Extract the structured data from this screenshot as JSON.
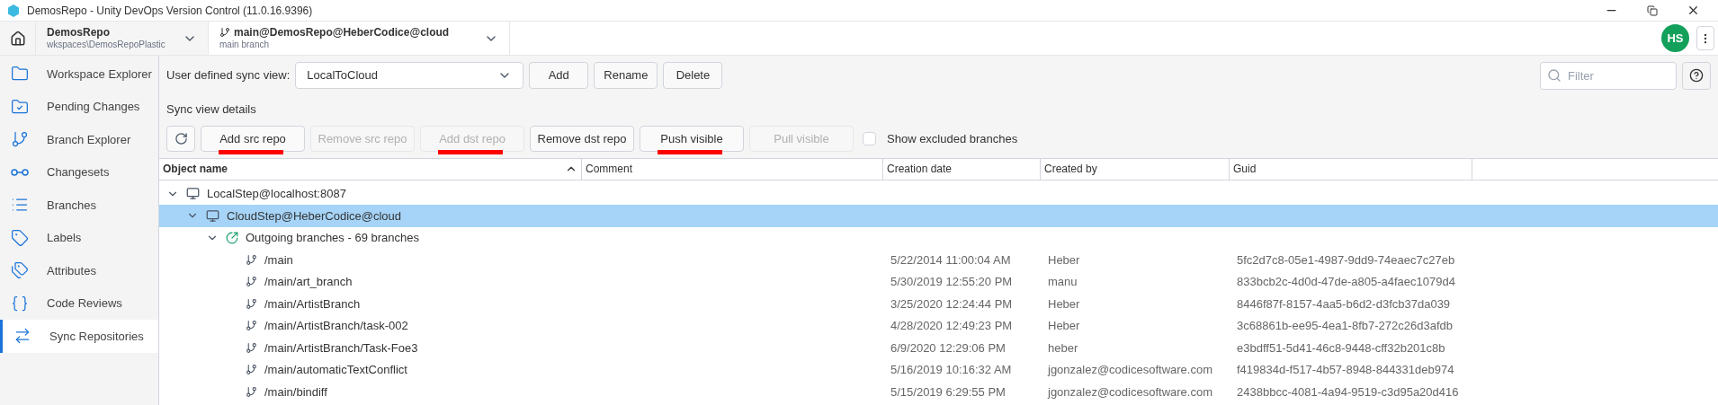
{
  "window": {
    "title": "DemosRepo - Unity DevOps Version Control (11.0.16.9396)"
  },
  "breadcrumbs": [
    {
      "kind": "workspace",
      "title": "DemosRepo",
      "subtitle": "wkspaces\\DemosRepoPlastic"
    },
    {
      "kind": "branch",
      "title": "main@DemosRepo@HeberCodice@cloud",
      "subtitle": "main branch"
    }
  ],
  "user": {
    "initials": "HS"
  },
  "sidebar": {
    "items": [
      {
        "kind": "folder",
        "label": "Workspace Explorer",
        "selected": false
      },
      {
        "kind": "pending",
        "label": "Pending Changes",
        "selected": false
      },
      {
        "kind": "branch-explorer",
        "label": "Branch Explorer",
        "selected": false
      },
      {
        "kind": "changesets",
        "label": "Changesets",
        "selected": false
      },
      {
        "kind": "list",
        "label": "Branches",
        "selected": false
      },
      {
        "kind": "label",
        "label": "Labels",
        "selected": false
      },
      {
        "kind": "attribute",
        "label": "Attributes",
        "selected": false
      },
      {
        "kind": "code",
        "label": "Code Reviews",
        "selected": false
      },
      {
        "kind": "sync",
        "label": "Sync Repositories",
        "selected": true
      }
    ]
  },
  "sync_view": {
    "label": "User defined sync view:",
    "value": "LocalToCloud",
    "buttons": [
      "Add",
      "Rename",
      "Delete"
    ]
  },
  "filter": {
    "placeholder": "Filter"
  },
  "details_label": "Sync view details",
  "actions": [
    {
      "label": "Add src repo",
      "disabled": false,
      "underlined": true
    },
    {
      "label": "Remove src repo",
      "disabled": true,
      "underlined": false
    },
    {
      "label": "Add dst repo",
      "disabled": true,
      "underlined": true
    },
    {
      "label": "Remove dst repo",
      "disabled": false,
      "underlined": false
    },
    {
      "label": "Push visible",
      "disabled": false,
      "underlined": true
    },
    {
      "label": "Pull visible",
      "disabled": true,
      "underlined": false
    }
  ],
  "show_excluded": {
    "label": "Show excluded branches",
    "checked": false
  },
  "table": {
    "columns": [
      "Object name",
      "Comment",
      "Creation date",
      "Created by",
      "Guid"
    ],
    "rows": [
      {
        "kind": "repo",
        "name": "LocalStep@localhost:8087",
        "expanded": true,
        "selected": false,
        "children": [
          {
            "kind": "repo",
            "name": "CloudStep@HeberCodice@cloud",
            "expanded": true,
            "selected": true,
            "children": [
              {
                "kind": "outgoing",
                "name": "Outgoing branches - 69 branches",
                "expanded": true,
                "selected": false,
                "children": [
                  {
                    "kind": "branch",
                    "name": "/main",
                    "selected": false,
                    "date": "5/22/2014 11:00:04 AM",
                    "author": "Heber",
                    "guid": "5fc2d7c8-05e1-4987-9dd9-74eaec7c27eb"
                  },
                  {
                    "kind": "branch",
                    "name": "/main/art_branch",
                    "selected": false,
                    "date": "5/30/2019 12:55:20 PM",
                    "author": "manu",
                    "guid": "833bcb2c-4d0d-47de-a805-a4faec1079d4"
                  },
                  {
                    "kind": "branch",
                    "name": "/main/ArtistBranch",
                    "selected": false,
                    "date": "3/25/2020 12:24:44 PM",
                    "author": "Heber",
                    "guid": "8446f87f-8157-4aa5-b6d2-d3fcb37da039"
                  },
                  {
                    "kind": "branch",
                    "name": "/main/ArtistBranch/task-002",
                    "selected": false,
                    "date": "4/28/2020 12:49:23 PM",
                    "author": "Heber",
                    "guid": "3c68861b-ee95-4ea1-8fb7-272c26d3afdb"
                  },
                  {
                    "kind": "branch",
                    "name": "/main/ArtistBranch/Task-Foe3",
                    "selected": false,
                    "date": "6/9/2020 12:29:06 PM",
                    "author": "heber",
                    "guid": "e3bdff51-5d41-46c8-9448-cff32b201c8b"
                  },
                  {
                    "kind": "branch",
                    "name": "/main/automaticTextConflict",
                    "selected": false,
                    "date": "5/16/2019 10:16:32 AM",
                    "author": "jgonzalez@codicesoftware.com",
                    "guid": "f419834d-f517-4b57-8948-844331deb974"
                  },
                  {
                    "kind": "branch",
                    "name": "/main/bindiff",
                    "selected": false,
                    "date": "5/15/2019 6:29:55 PM",
                    "author": "jgonzalez@codicesoftware.com",
                    "guid": "2438bbcc-4081-4a94-9519-c3d95a20d416"
                  }
                ]
              }
            ]
          }
        ]
      }
    ]
  }
}
